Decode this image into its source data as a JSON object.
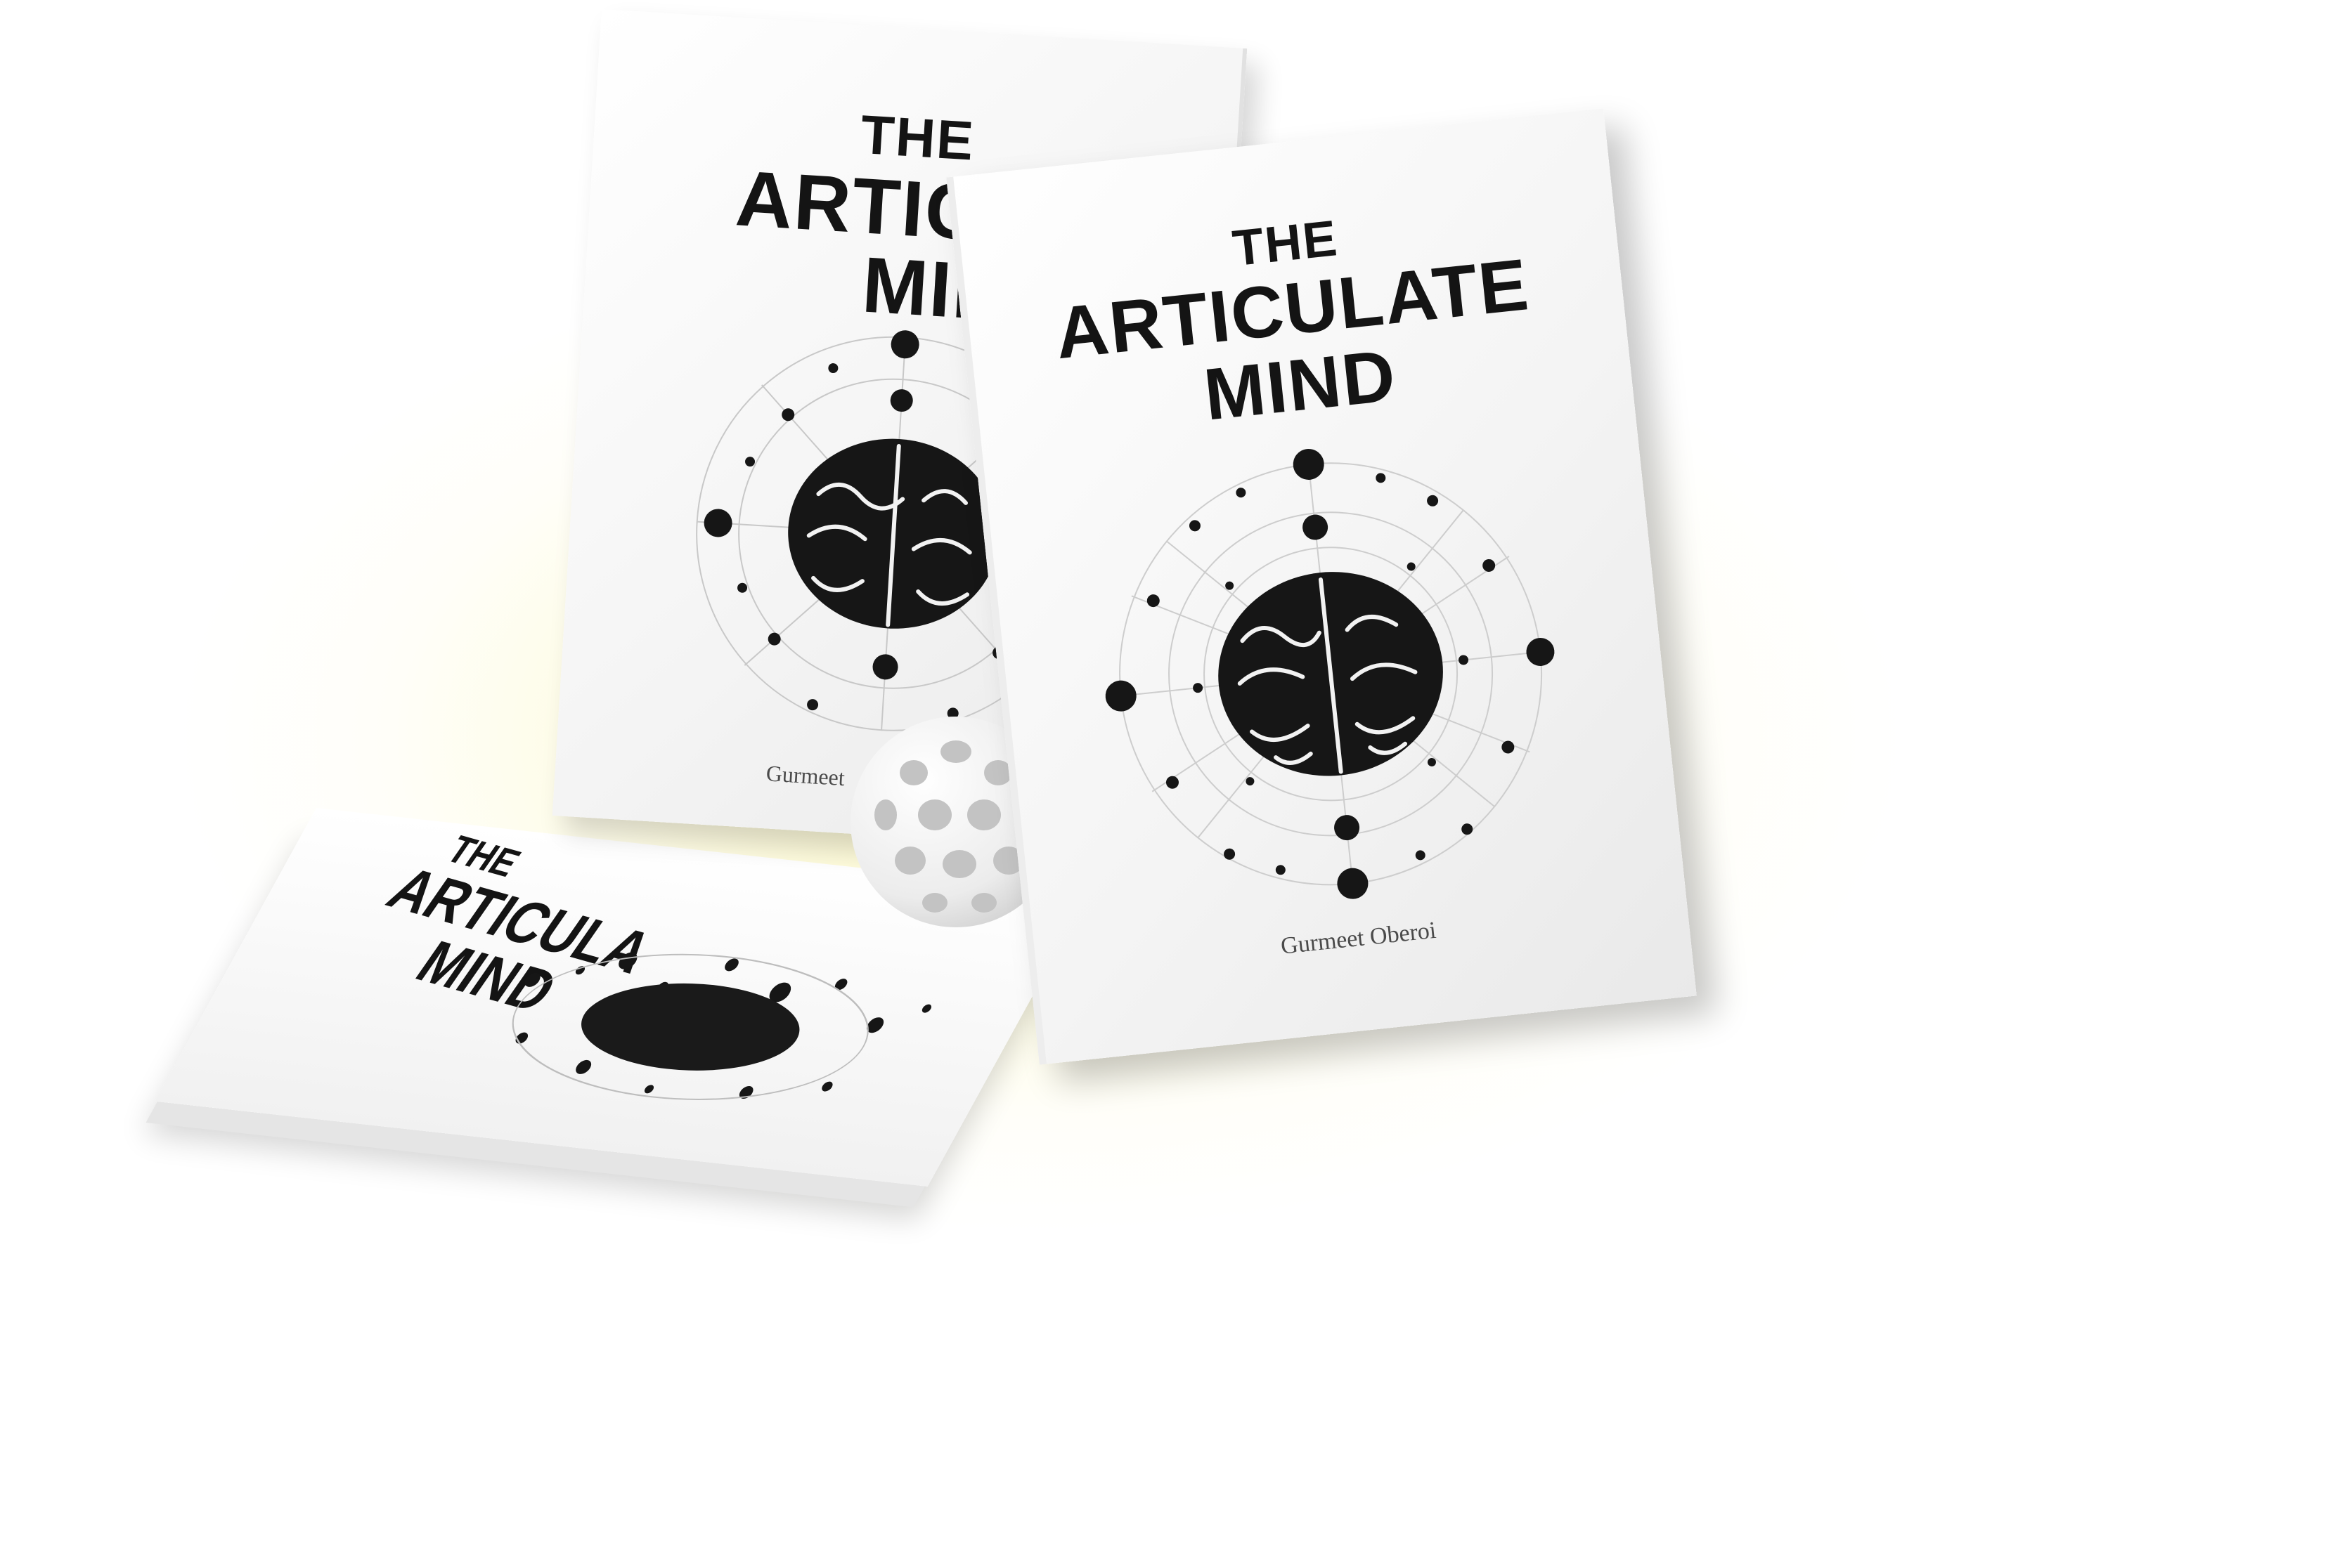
{
  "scene": {
    "glow_color": "#fdf8c4",
    "book_color": "#f4f4f4",
    "ink_color": "#141414"
  },
  "books": {
    "back": {
      "the": "THE",
      "title": "ARTICUL",
      "mind": "MIN",
      "author": "Gurmeet"
    },
    "front": {
      "the": "THE",
      "title": "ARTICULATE",
      "mind": "MIND",
      "author": "Gurmeet Oberoi"
    },
    "flat": {
      "the": "THE",
      "title": "ARTICULA",
      "mind": "MIND"
    }
  }
}
